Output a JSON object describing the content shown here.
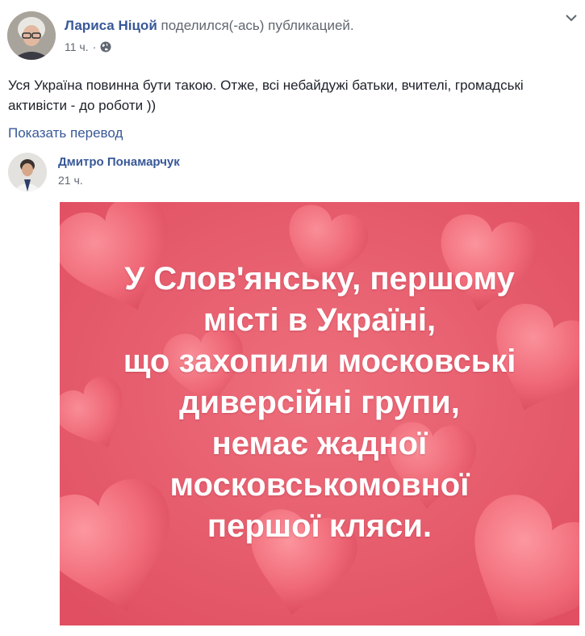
{
  "post": {
    "author": "Лариса Ніцой",
    "shared_text": "поделился(-ась) публикацией.",
    "time": "11 ч.",
    "separator": "·",
    "privacy_icon": "globe-icon",
    "menu_icon": "caret-down-icon",
    "text": "Уся Україна повинна бути такою. Отже, всі небайдужі батьки, вчителі, громадські активісти - до роботи ))",
    "translate_link": "Показать перевод"
  },
  "shared_post": {
    "author": "Дмитро Понамарчук",
    "time": "21 ч.",
    "image_text_lines": [
      "У Слов'янську, першому",
      "місті в Україні,",
      "що захопили московські",
      "диверсійні групи,",
      "немає жадної",
      "московськомовної",
      "першої кляси."
    ]
  },
  "colors": {
    "link": "#385898",
    "meta": "#606770",
    "image_background": "#e8596a",
    "heart": "#f27a86"
  }
}
